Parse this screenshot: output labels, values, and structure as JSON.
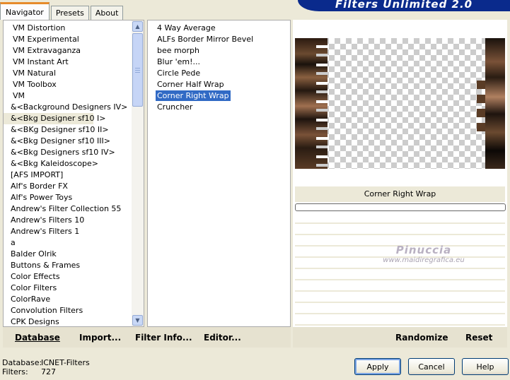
{
  "tabs": [
    "Navigator",
    "Presets",
    "About"
  ],
  "banner_title": "Filters Unlimited 2.0",
  "categories": [
    "VM Distortion",
    "VM Experimental",
    "VM Extravaganza",
    "VM Instant Art",
    "VM Natural",
    "VM Toolbox",
    "VM",
    "&<Background Designers IV>",
    "&<Bkg Designer sf10 I>",
    "&<BKg Designer sf10 II>",
    "&<Bkg Designer sf10 III>",
    "&<Bkg Designers sf10 IV>",
    "&<Bkg Kaleidoscope>",
    "[AFS IMPORT]",
    "Alf's Border FX",
    "Alf's Power Toys",
    "Andrew's Filter Collection 55",
    "Andrew's Filters 10",
    "Andrew's Filters 1",
    "a",
    "Balder Olrik",
    "Buttons & Frames",
    "Color Effects",
    "Color Filters",
    "ColorRave",
    "Convolution Filters",
    "CPK Designs"
  ],
  "selected_category": "&<Bkg Designer sf10 I>",
  "filters": [
    "4 Way Average",
    "ALFs Border Mirror Bevel",
    "bee morph",
    "Blur 'em!...",
    "Circle Pede",
    "Corner Half Wrap",
    "Corner Right Wrap",
    "Cruncher"
  ],
  "selected_filter": "Corner Right Wrap",
  "toolbar": {
    "database": "Database",
    "import": "Import...",
    "filter_info": "Filter Info...",
    "editor": "Editor...",
    "randomize": "Randomize",
    "reset": "Reset"
  },
  "preview_filter_name": "Corner Right Wrap",
  "watermark": {
    "line1": "Pinuccia",
    "line2": "www.maidiregrafica.eu"
  },
  "status": {
    "database_label": "Database:",
    "database_value": "ICNET-Filters",
    "filters_label": "Filters:",
    "filters_value": "727"
  },
  "buttons": {
    "apply": "Apply",
    "cancel": "Cancel",
    "help": "Help"
  }
}
